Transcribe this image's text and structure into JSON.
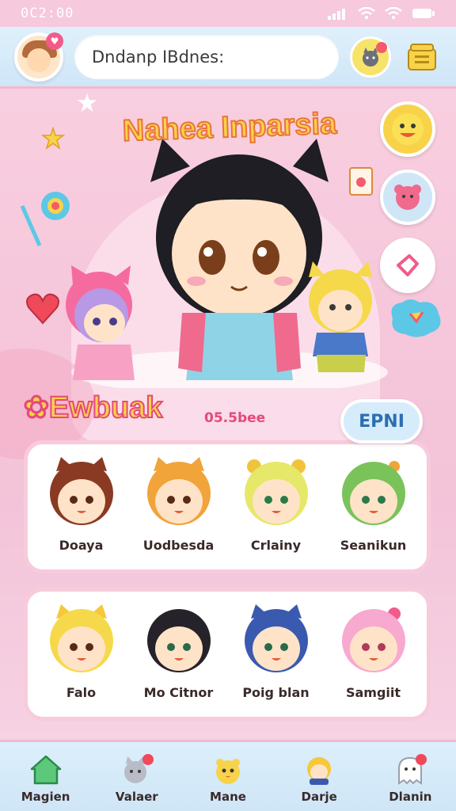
{
  "status": {
    "time": "0C2:00"
  },
  "header": {
    "search_placeholder": "Dndanp IBdnes:"
  },
  "hero": {
    "title": "Nahea Inparsia"
  },
  "section": {
    "title": "Ewbuak",
    "subtitle": "05.5bee",
    "action_label": "EPNI"
  },
  "characters_row1": [
    {
      "name": "Doaya"
    },
    {
      "name": "Uodbesda"
    },
    {
      "name": "Crlainy"
    },
    {
      "name": "Seanikun"
    }
  ],
  "characters_row2": [
    {
      "name": "Falo"
    },
    {
      "name": "Mo Citnor"
    },
    {
      "name": "Poig blan"
    },
    {
      "name": "Samgiit"
    }
  ],
  "nav": [
    {
      "label": "Magien",
      "icon": "home-icon"
    },
    {
      "label": "Valaer",
      "icon": "cat-icon"
    },
    {
      "label": "Mane",
      "icon": "chick-icon"
    },
    {
      "label": "Darje",
      "icon": "character-icon"
    },
    {
      "label": "Dlanin",
      "icon": "ghost-icon"
    }
  ],
  "colors": {
    "accent_pink": "#f35a8a",
    "accent_yellow": "#fbd14a",
    "accent_blue": "#2b6fb0"
  }
}
